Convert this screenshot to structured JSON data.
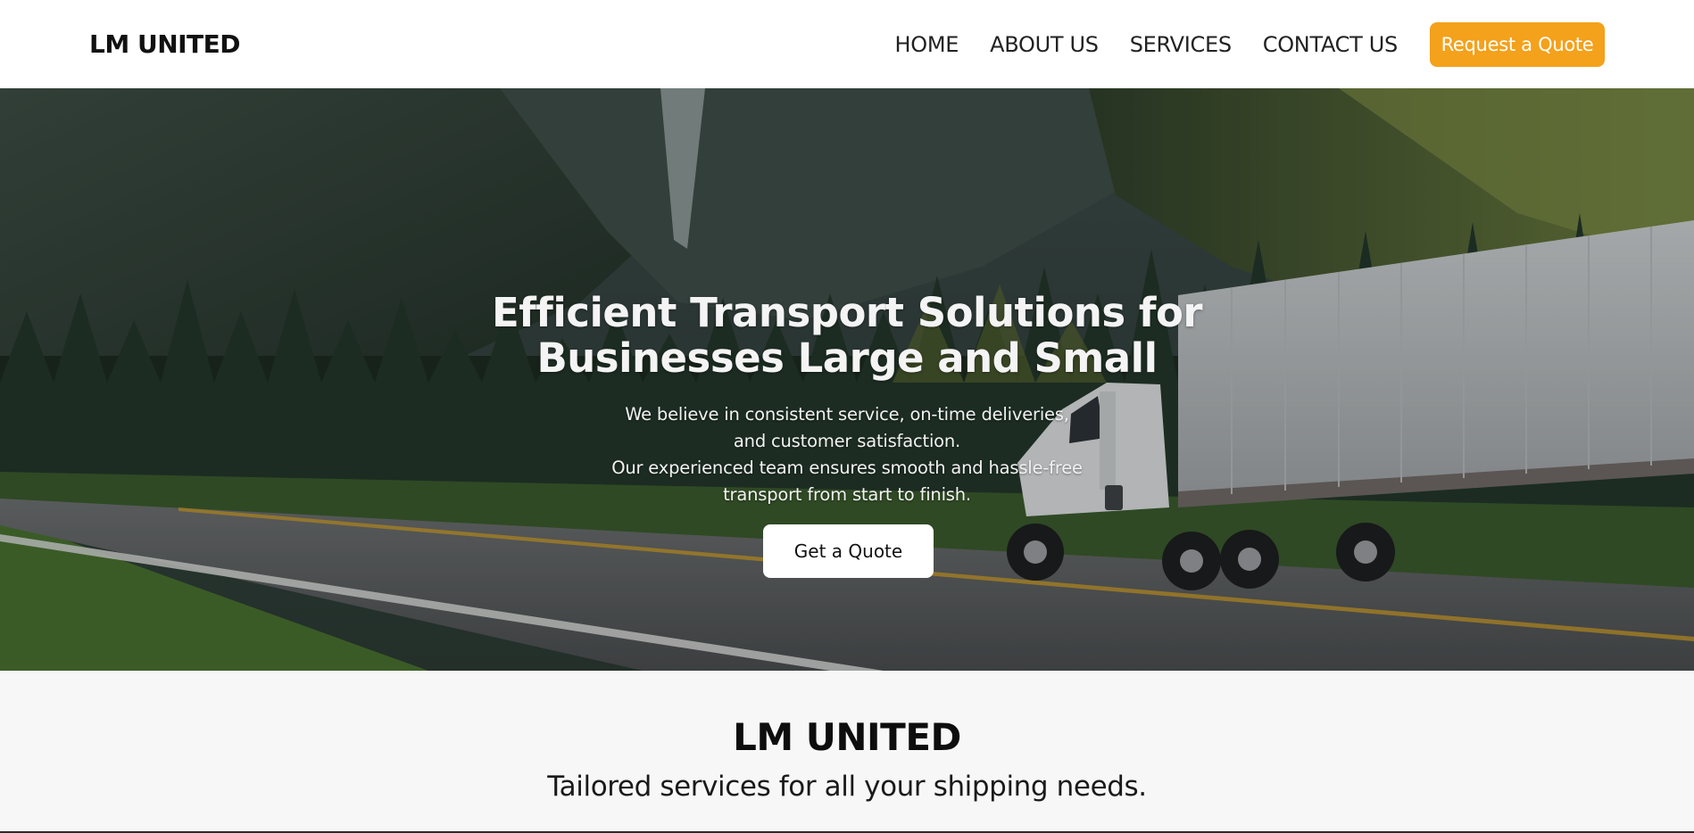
{
  "header": {
    "brand": "LM UNITED",
    "nav": [
      "HOME",
      "ABOUT US",
      "SERVICES",
      "CONTACT US"
    ],
    "cta": "Request a Quote"
  },
  "hero": {
    "title_lines": [
      "Efficient Transport Solutions for",
      "Businesses Large and Small"
    ],
    "subtitle_lines": [
      "We believe in consistent service, on-time deliveries,",
      "and customer satisfaction.",
      "Our experienced team ensures smooth and hassle-free",
      "transport from start to finish."
    ],
    "button": "Get a Quote",
    "image": "truck-on-mountain-highway"
  },
  "intro": {
    "title": "LM UNITED",
    "subtitle": "Tailored services for all your shipping needs."
  },
  "colors": {
    "accent": "#f4a11b",
    "header_bg": "#ffffff",
    "section_bg": "#f7f7f7"
  }
}
